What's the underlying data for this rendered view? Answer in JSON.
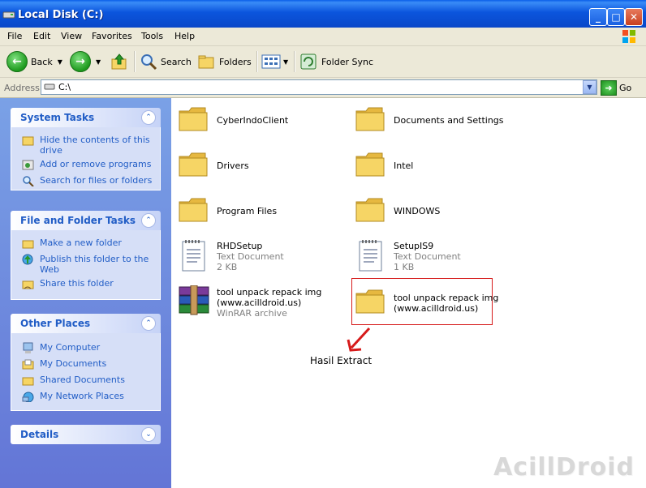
{
  "window": {
    "title": "Local Disk (C:)",
    "min": "_",
    "max": "□",
    "close": "✕"
  },
  "menu": [
    "File",
    "Edit",
    "View",
    "Favorites",
    "Tools",
    "Help"
  ],
  "toolbar": {
    "back": "Back",
    "search": "Search",
    "folders": "Folders",
    "folder_sync": "Folder Sync"
  },
  "address": {
    "label": "Address",
    "value": "C:\\",
    "go": "Go"
  },
  "panels": {
    "system_tasks": {
      "title": "System Tasks",
      "items": [
        "Hide the contents of this drive",
        "Add or remove programs",
        "Search for files or folders"
      ]
    },
    "file_folder_tasks": {
      "title": "File and Folder Tasks",
      "items": [
        "Make a new folder",
        "Publish this folder to the Web",
        "Share this folder"
      ]
    },
    "other_places": {
      "title": "Other Places",
      "items": [
        "My Computer",
        "My Documents",
        "Shared Documents",
        "My Network Places"
      ]
    },
    "details": {
      "title": "Details"
    }
  },
  "files": {
    "cyberindo": {
      "name": "CyberIndoClient"
    },
    "docs_settings": {
      "name": "Documents and Settings"
    },
    "drivers": {
      "name": "Drivers"
    },
    "intel": {
      "name": "Intel"
    },
    "program_files": {
      "name": "Program Files"
    },
    "windows": {
      "name": "WINDOWS"
    },
    "rhdsetup": {
      "name": "RHDSetup",
      "type": "Text Document",
      "size": "2 KB"
    },
    "setupis9": {
      "name": "SetupIS9",
      "type": "Text Document",
      "size": "1 KB"
    },
    "tool_rar": {
      "name1": "tool unpack repack img",
      "name2": "(www.acilldroid.us)",
      "type": "WinRAR archive"
    },
    "tool_folder": {
      "name1": "tool unpack repack img",
      "name2": "(www.acilldroid.us)"
    }
  },
  "annotation": "Hasil Extract",
  "watermark": "AcillDroid",
  "colors": {
    "folder_yellow": "#f6d565",
    "accent_blue": "#215dc6",
    "highlight_red": "#d61a1a"
  }
}
